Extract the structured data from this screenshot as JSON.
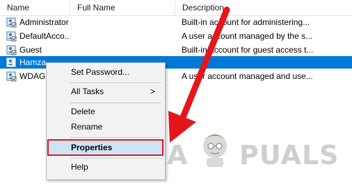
{
  "columns": {
    "name": "Name",
    "full_name": "Full Name",
    "description": "Description"
  },
  "rows": [
    {
      "name": "Administrator",
      "full_name": "",
      "description": "Built-in account for administering...",
      "selected": false
    },
    {
      "name": "DefaultAcco...",
      "full_name": "",
      "description": "A user account managed by the s...",
      "selected": false
    },
    {
      "name": "Guest",
      "full_name": "",
      "description": "Built-in account for guest access t...",
      "selected": false
    },
    {
      "name": "Hamza",
      "full_name": "",
      "description": "",
      "selected": true
    },
    {
      "name": "WDAGU...",
      "full_name": "",
      "description": "A user account managed and use...",
      "selected": false
    }
  ],
  "context_menu": {
    "set_password": "Set Password...",
    "all_tasks": "All Tasks",
    "all_tasks_chevron": ">",
    "delete": "Delete",
    "rename": "Rename",
    "properties": "Properties",
    "help": "Help"
  },
  "watermark": {
    "letter_a": "A",
    "rest": "PUALS"
  },
  "colors": {
    "selection": "#0078d7",
    "highlight_border": "#e3171b",
    "arrow": "#e3171b"
  },
  "icons": {
    "user": "user-account-icon"
  }
}
